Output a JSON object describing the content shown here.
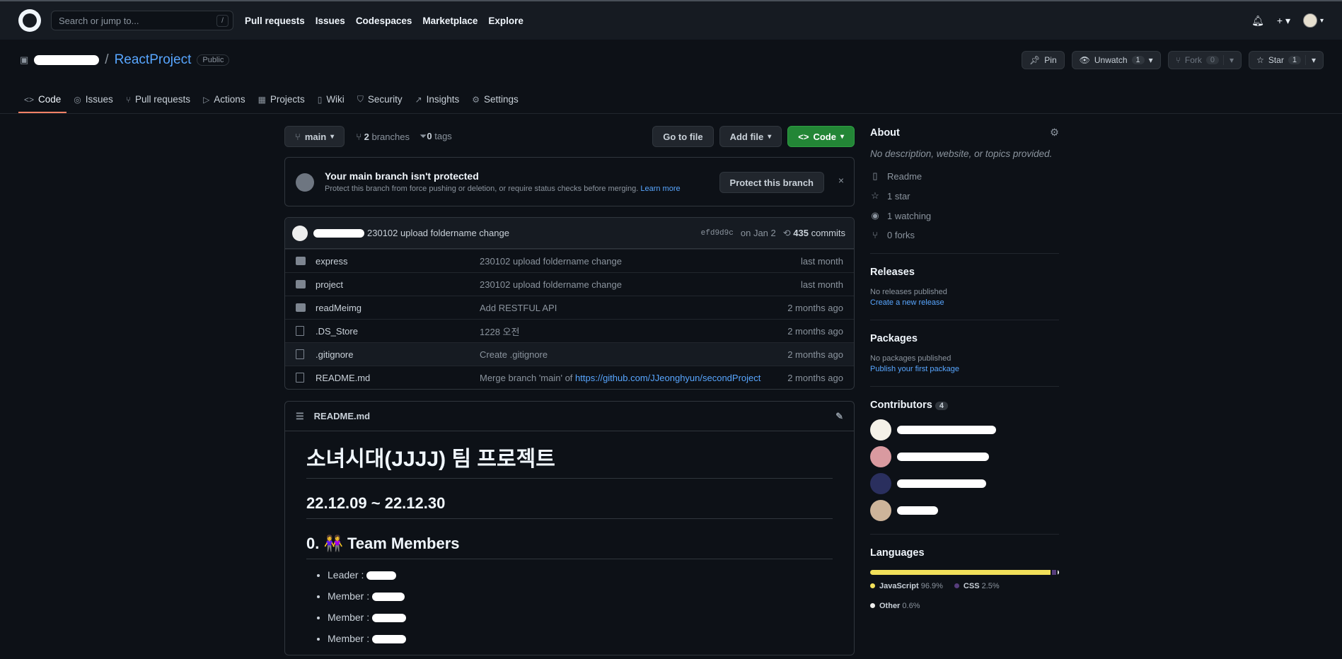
{
  "header": {
    "search_placeholder": "Search or jump to...",
    "search_shortcut": "/",
    "nav": [
      "Pull requests",
      "Issues",
      "Codespaces",
      "Marketplace",
      "Explore"
    ]
  },
  "repo": {
    "separator": "/",
    "name": "ReactProject",
    "visibility": "Public",
    "pin_label": "Pin",
    "unwatch_label": "Unwatch",
    "unwatch_count": "1",
    "fork_label": "Fork",
    "fork_count": "0",
    "star_label": "Star",
    "star_count": "1"
  },
  "tabs": [
    {
      "label": "Code",
      "icon": "<>"
    },
    {
      "label": "Issues",
      "icon": "◎"
    },
    {
      "label": "Pull requests",
      "icon": "⑂"
    },
    {
      "label": "Actions",
      "icon": "▷"
    },
    {
      "label": "Projects",
      "icon": "▦"
    },
    {
      "label": "Wiki",
      "icon": "▯"
    },
    {
      "label": "Security",
      "icon": "⛉"
    },
    {
      "label": "Insights",
      "icon": "↗"
    },
    {
      "label": "Settings",
      "icon": "⚙"
    }
  ],
  "branchbar": {
    "branch": "main",
    "branches_count": "2",
    "branches_label": "branches",
    "tags_count": "0",
    "tags_label": "tags",
    "go_to_file": "Go to file",
    "add_file": "Add file",
    "code": "Code"
  },
  "protect": {
    "title": "Your main branch isn't protected",
    "subtitle": "Protect this branch from force pushing or deletion, or require status checks before merging.",
    "learn_more": "Learn more",
    "button": "Protect this branch",
    "close": "×"
  },
  "commit": {
    "message": "230102 upload foldername change",
    "sha": "efd9d9c",
    "date": "on Jan 2",
    "count": "435",
    "count_label": "commits"
  },
  "files": [
    {
      "type": "folder",
      "name": "express",
      "message": "230102 upload foldername change",
      "time": "last month"
    },
    {
      "type": "folder",
      "name": "project",
      "message": "230102 upload foldername change",
      "time": "last month"
    },
    {
      "type": "folder",
      "name": "readMeimg",
      "message": "Add RESTFUL API",
      "time": "2 months ago"
    },
    {
      "type": "file",
      "name": ".DS_Store",
      "message": "1228 오전",
      "time": "2 months ago"
    },
    {
      "type": "file",
      "name": ".gitignore",
      "message": "Create .gitignore",
      "time": "2 months ago"
    },
    {
      "type": "file",
      "name": "README.md",
      "message": "Merge branch 'main' of",
      "link": "https://github.com/JJeonghyun/secondProject",
      "time": "2 months ago"
    }
  ],
  "readme": {
    "filename": "README.md",
    "h1": "소녀시대(JJJJ) 팀 프로젝트",
    "date_heading": "22.12.09 ~ 22.12.30",
    "members_heading": "0. 👭 Team Members",
    "members": [
      "Leader :",
      "Member :",
      "Member :",
      "Member :"
    ]
  },
  "sidebar": {
    "about_title": "About",
    "about_desc": "No description, website, or topics provided.",
    "readme": "Readme",
    "stars": "1 star",
    "watching": "1 watching",
    "forks": "0 forks",
    "releases_title": "Releases",
    "releases_sub": "No releases published",
    "releases_link": "Create a new release",
    "packages_title": "Packages",
    "packages_sub": "No packages published",
    "packages_link": "Publish your first package",
    "contributors_title": "Contributors",
    "contributors_count": "4",
    "languages_title": "Languages",
    "languages": [
      {
        "name": "JavaScript",
        "pct": "96.9%",
        "value": 96.9,
        "color": "#f1e05a"
      },
      {
        "name": "CSS",
        "pct": "2.5%",
        "value": 2.5,
        "color": "#563d7c"
      },
      {
        "name": "Other",
        "pct": "0.6%",
        "value": 0.6,
        "color": "#ededed"
      }
    ]
  }
}
